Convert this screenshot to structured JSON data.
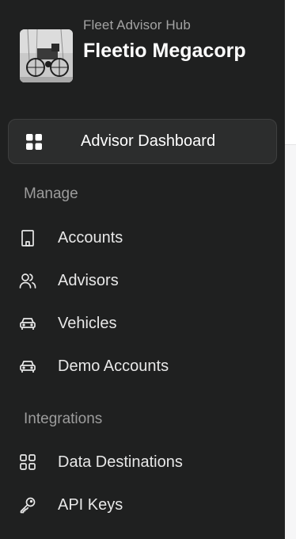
{
  "org": {
    "subtitle": "Fleet Advisor Hub",
    "name": "Fleetio Megacorp",
    "logo_icon": "vintage-car-photo"
  },
  "nav": {
    "active": {
      "label": "Advisor Dashboard",
      "icon": "dashboard-grid-icon"
    },
    "sections": [
      {
        "title": "Manage",
        "items": [
          {
            "label": "Accounts",
            "icon": "building-icon"
          },
          {
            "label": "Advisors",
            "icon": "users-icon"
          },
          {
            "label": "Vehicles",
            "icon": "car-icon"
          },
          {
            "label": "Demo Accounts",
            "icon": "car-icon"
          }
        ]
      },
      {
        "title": "Integrations",
        "items": [
          {
            "label": "Data Destinations",
            "icon": "grid-outline-icon"
          },
          {
            "label": "API Keys",
            "icon": "key-icon"
          }
        ]
      }
    ]
  },
  "colors": {
    "sidebar_bg": "#1f2020",
    "active_bg": "#2c2d2d",
    "text": "#ffffff",
    "muted": "#9c9c9c"
  }
}
